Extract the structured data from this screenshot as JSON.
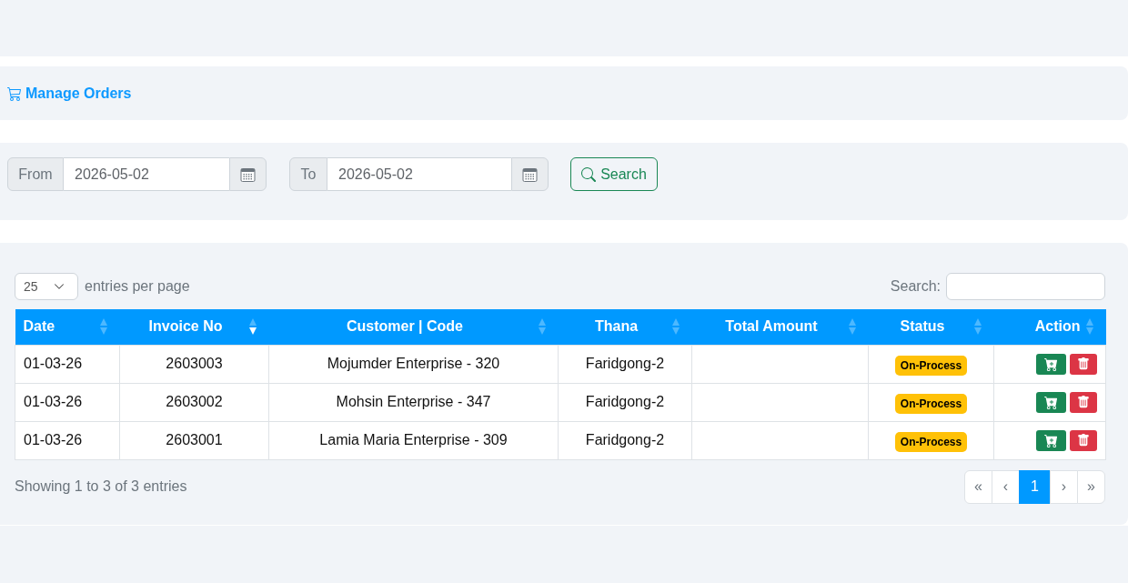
{
  "page_title": "Manage Orders",
  "filter": {
    "from": {
      "label": "From",
      "value": "2026-05-02"
    },
    "to": {
      "label": "To",
      "value": "2026-05-02"
    },
    "search_button": "Search"
  },
  "table_controls": {
    "page_size": "25",
    "page_size_label": "entries per page",
    "search_label": "Search:"
  },
  "table": {
    "columns": [
      {
        "label": "Date",
        "sorted": false
      },
      {
        "label": "Invoice No",
        "sorted": true
      },
      {
        "label": "Customer | Code",
        "sorted": false
      },
      {
        "label": "Thana",
        "sorted": false
      },
      {
        "label": "Total Amount",
        "sorted": false
      },
      {
        "label": "Status",
        "sorted": false
      },
      {
        "label": "Action",
        "sorted": false
      }
    ],
    "rows": [
      {
        "date": "01-03-26",
        "invoice_no": "2603003",
        "customer": "Mojumder Enterprise - 320",
        "thana": "Faridgong-2",
        "status": "On-Process"
      },
      {
        "date": "01-03-26",
        "invoice_no": "2603002",
        "customer": "Mohsin Enterprise - 347",
        "thana": "Faridgong-2",
        "status": "On-Process"
      },
      {
        "date": "01-03-26",
        "invoice_no": "2603001",
        "customer": "Lamia Maria Enterprise - 309",
        "thana": "Faridgong-2",
        "status": "On-Process"
      }
    ]
  },
  "footer": {
    "info": "Showing 1 to 3 of 3 entries",
    "pagination": [
      {
        "label": "«",
        "selected": false
      },
      {
        "label": "‹",
        "selected": false
      },
      {
        "label": "1",
        "selected": true
      },
      {
        "label": "›",
        "selected": false
      },
      {
        "label": "»",
        "selected": false
      }
    ]
  }
}
